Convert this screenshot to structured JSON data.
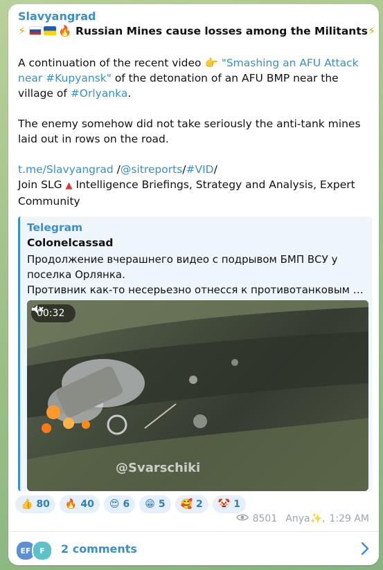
{
  "channel_name": "Slavyangrad",
  "headline": "Russian Mines cause losses among the Militants",
  "paragraph1": {
    "prefix": "A continuation of the recent video",
    "link1": "\"Smashing an AFU Attack near #Kupyansk\"",
    "middle": " of the detonation of an AFU BMP near the village of ",
    "hashtag": "#Orlyanka",
    "suffix": "."
  },
  "paragraph2": "The enemy somehow did not take seriously the anti-tank mines laid out in rows on the road.",
  "links": {
    "tme": "t.me/Slavyangrad",
    "sep1": " /",
    "sitreports": "@sitreports",
    "sep2": "/",
    "vid": "#VID",
    "sep3": "/"
  },
  "join_line": {
    "prefix": "Join SLG",
    "suffix": " Intelligence Briefings, Strategy and Analysis, Expert Community"
  },
  "quote": {
    "source": "Telegram",
    "author": "Colonelcassad",
    "line1": "Продолжение вчерашнего видео с подрывом БМП ВСУ у поселка Орлянка.",
    "line2": "Противник как-то несерьезно отнесся к противотанковым м..."
  },
  "video": {
    "duration": "00:32",
    "watermark": "@Svarschiki"
  },
  "reactions": [
    {
      "emoji": "👍",
      "count": "80"
    },
    {
      "emoji": "🔥",
      "count": "40"
    },
    {
      "emoji": "😍",
      "count": "6"
    },
    {
      "emoji": "😁",
      "count": "5"
    },
    {
      "emoji": "🥰",
      "count": "2"
    },
    {
      "emoji": "🤡",
      "count": "1"
    }
  ],
  "meta": {
    "views": "8501",
    "author": "Anya✨,",
    "time": "1:29 AM"
  },
  "comments": {
    "avatar1": "EF",
    "avatar2": "F",
    "label": "2 comments"
  },
  "colors": {
    "accent": "#3a8fc8",
    "avatar1": "#5b8fd6",
    "avatar2": "#5cc1c8"
  },
  "icons": [
    "lightning-icon",
    "flag-ru-icon",
    "flag-ua-icon",
    "fire-icon",
    "pointing-hand-icon",
    "red-triangle-icon",
    "mute-icon",
    "eye-icon",
    "chevron-right-icon"
  ]
}
